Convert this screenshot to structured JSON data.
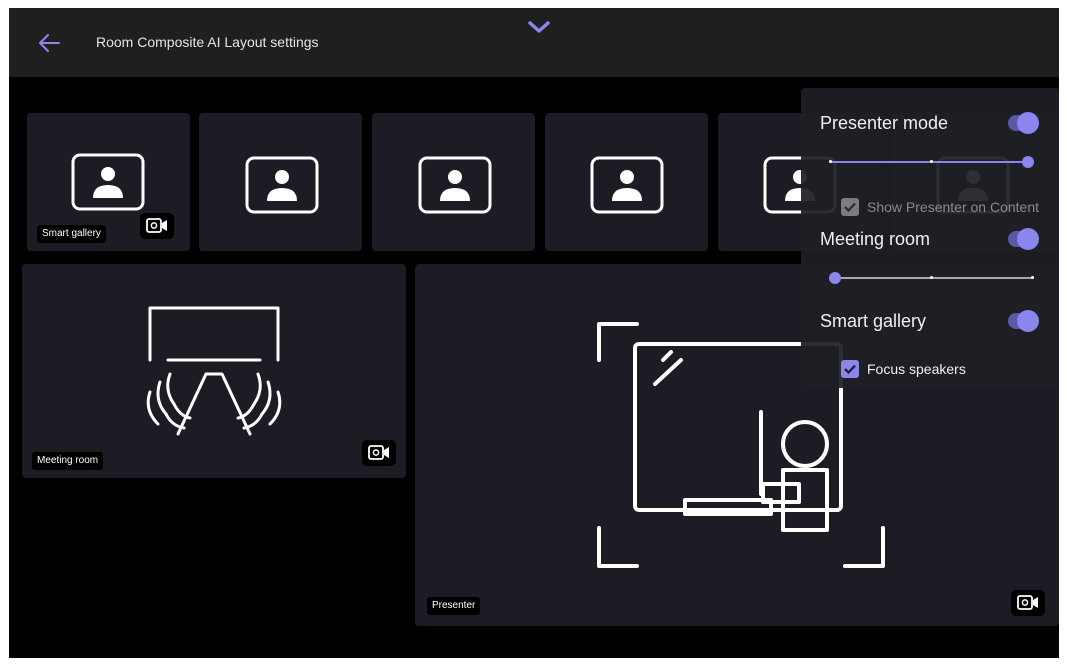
{
  "header": {
    "title": "Room Composite AI Layout settings"
  },
  "tiles": {
    "smart_gallery_label": "Smart gallery",
    "meeting_room_label": "Meeting room",
    "presenter_label": "Presenter"
  },
  "panel": {
    "presenter_mode": {
      "label": "Presenter mode",
      "enabled": true,
      "slider_value": 1.0
    },
    "show_presenter": {
      "label": "Show Presenter on Content",
      "checked": true,
      "disabled": true
    },
    "meeting_room": {
      "label": "Meeting room",
      "enabled": true,
      "slider_value": 0.0
    },
    "smart_gallery": {
      "label": "Smart gallery",
      "enabled": true
    },
    "focus_speakers": {
      "label": "Focus speakers",
      "checked": true
    }
  },
  "colors": {
    "accent": "#8b86ee",
    "accent_dark": "#5b58a8",
    "tile_bg": "#1c1d24",
    "header_bg": "#1f1f1f"
  },
  "icons": [
    "back-arrow-icon",
    "chevron-down-icon",
    "person-frame-icon",
    "camera-settings-icon",
    "meeting-table-icon",
    "presenter-whiteboard-icon",
    "check-icon"
  ]
}
